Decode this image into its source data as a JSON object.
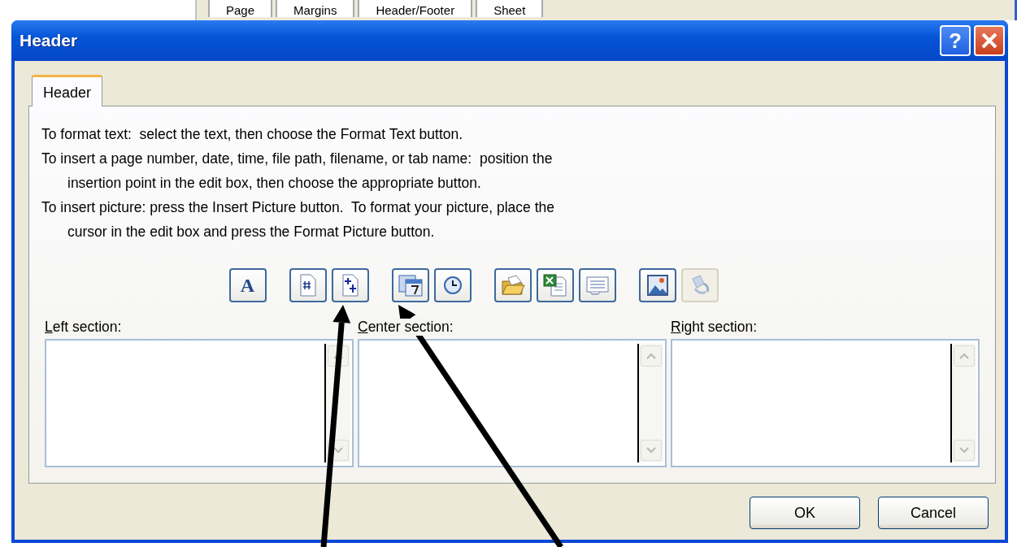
{
  "background_tabs": [
    {
      "label": "Page"
    },
    {
      "label": "Margins"
    },
    {
      "label": "Header/Footer"
    },
    {
      "label": "Sheet"
    }
  ],
  "window": {
    "title": "Header",
    "help": "?"
  },
  "tabs": [
    {
      "label": "Header",
      "selected": true
    }
  ],
  "instructions": [
    "To format text:  select the text, then choose the Format Text button.",
    "To insert a page number, date, time, file path, filename, or tab name:  position the",
    "insertion point in the edit box, then choose the appropriate button.",
    "To insert picture: press the Insert Picture button.  To format your picture, place the",
    "cursor in the edit box and press the Format Picture button."
  ],
  "toolbar": [
    [
      {
        "kind": "text",
        "label": "A",
        "disabled": false
      }
    ],
    [
      {
        "kind": "page-number",
        "disabled": false
      },
      {
        "kind": "page-count",
        "disabled": false
      }
    ],
    [
      {
        "kind": "date",
        "disabled": false
      },
      {
        "kind": "time",
        "disabled": false
      }
    ],
    [
      {
        "kind": "folder",
        "disabled": false
      },
      {
        "kind": "workbook",
        "disabled": false
      },
      {
        "kind": "sheet",
        "disabled": false
      }
    ],
    [
      {
        "kind": "picture",
        "disabled": false
      },
      {
        "kind": "format-picture",
        "disabled": true
      }
    ]
  ],
  "sections": [
    {
      "label": "Left section:"
    },
    {
      "label": "Center section:"
    },
    {
      "label": "Right section:"
    }
  ],
  "buttons": [
    {
      "label": "OK"
    },
    {
      "label": "Cancel"
    }
  ],
  "annotations": [
    {
      "kind": "arrow"
    },
    {
      "kind": "arrow"
    }
  ]
}
